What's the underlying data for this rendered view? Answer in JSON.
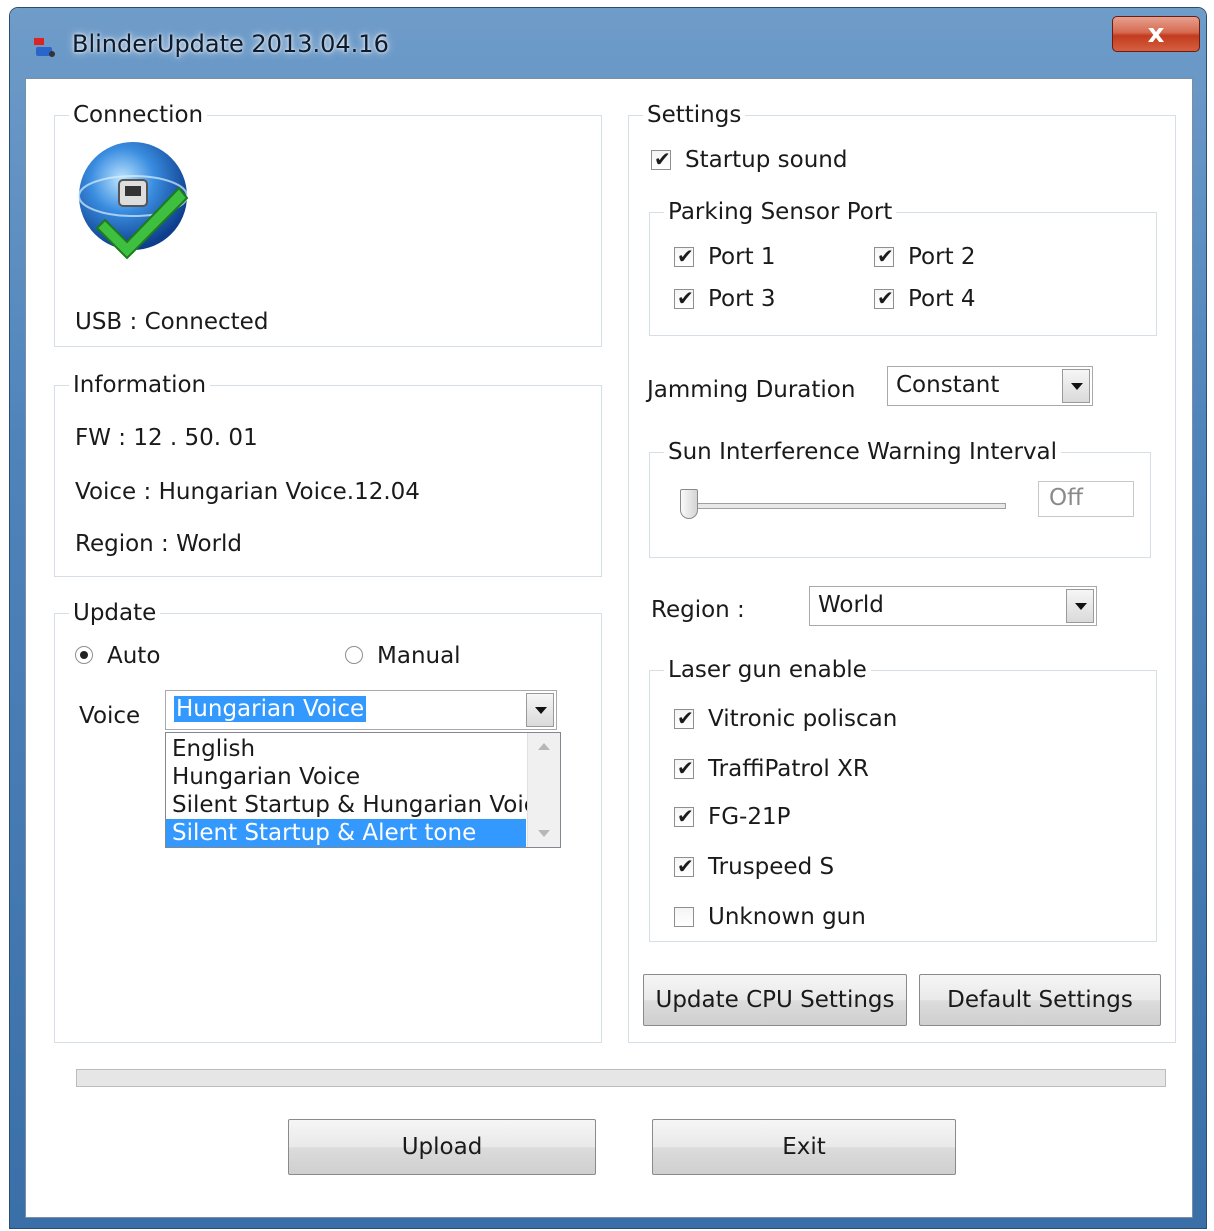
{
  "window": {
    "title": "BlinderUpdate 2013.04.16",
    "close_glyph": "x",
    "app_icon": "app-logo-icon"
  },
  "connection": {
    "group_title": "Connection",
    "status_icon": "usb-connected-icon",
    "status_text": "USB : Connected"
  },
  "information": {
    "group_title": "Information",
    "fw": "FW : 12 . 50. 01",
    "voice": "Voice : Hungarian Voice.12.04",
    "region": "Region : World"
  },
  "update": {
    "group_title": "Update",
    "auto_label": "Auto",
    "manual_label": "Manual",
    "auto_checked": true,
    "manual_checked": false,
    "voice_label": "Voice",
    "voice_selected": "Hungarian Voice",
    "voice_options": [
      "English",
      "Hungarian Voice",
      "Silent Startup & Hungarian Voice",
      "Silent Startup & Alert tone"
    ],
    "highlighted_option": "Silent Startup & Alert tone"
  },
  "settings": {
    "group_title": "Settings",
    "startup_sound": {
      "label": "Startup sound",
      "checked": true
    },
    "parking_sensor": {
      "group_title": "Parking Sensor Port",
      "ports": [
        {
          "label": "Port 1",
          "checked": true
        },
        {
          "label": "Port 2",
          "checked": true
        },
        {
          "label": "Port 3",
          "checked": true
        },
        {
          "label": "Port 4",
          "checked": true
        }
      ]
    },
    "jamming_duration": {
      "label": "Jamming Duration",
      "value": "Constant"
    },
    "sun_interference": {
      "group_title": "Sun Interference Warning Interval",
      "value": "Off",
      "slider_level": 0
    },
    "region": {
      "label": "Region :",
      "value": "World"
    },
    "laser_gun": {
      "group_title": "Laser gun enable",
      "items": [
        {
          "label": "Vitronic poliscan",
          "checked": true
        },
        {
          "label": "TraffiPatrol XR",
          "checked": true
        },
        {
          "label": "FG-21P",
          "checked": true
        },
        {
          "label": "Truspeed S",
          "checked": true
        },
        {
          "label": "Unknown gun",
          "checked": false
        }
      ]
    },
    "update_cpu_button": "Update CPU Settings",
    "default_button": "Default Settings"
  },
  "progress": {
    "value_percent": 0
  },
  "footer": {
    "upload_button": "Upload",
    "exit_button": "Exit"
  },
  "check_glyph": "✔"
}
